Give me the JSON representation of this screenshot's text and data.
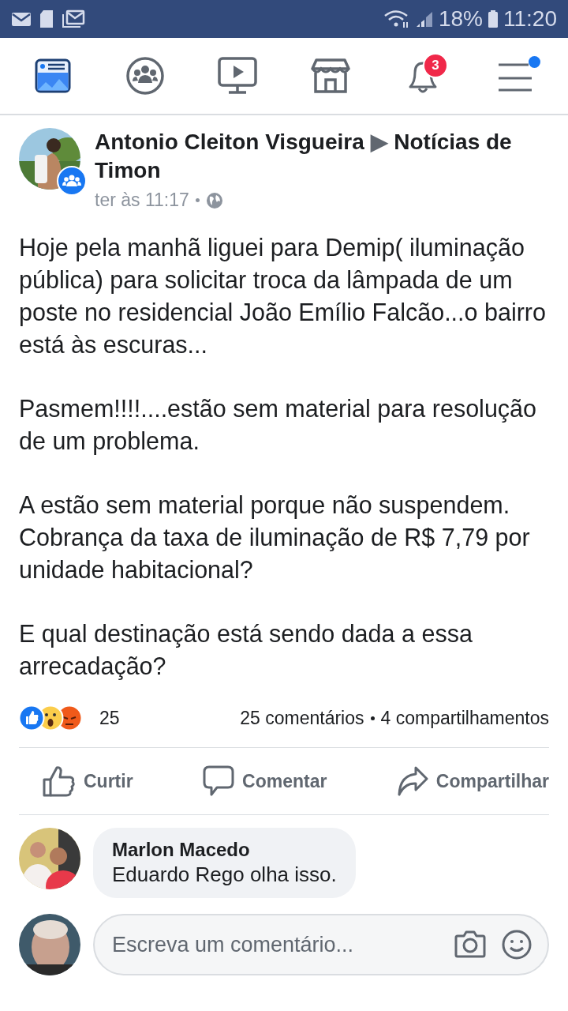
{
  "status_bar": {
    "battery": "18%",
    "time": "11:20"
  },
  "nav_tabs": [
    {
      "kind": "news",
      "selected": true
    },
    {
      "kind": "groups",
      "selected": false
    },
    {
      "kind": "video",
      "selected": false
    },
    {
      "kind": "market",
      "selected": false
    },
    {
      "kind": "bell",
      "selected": false,
      "badge": "3"
    },
    {
      "kind": "menu",
      "selected": false,
      "unread_dot": true
    }
  ],
  "post": {
    "author": "Antonio Cleiton Visgueira",
    "separator": "▶",
    "group": "Notícias de Timon",
    "time": "ter às 11:17",
    "paragraphs": [
      "Hoje pela manhã liguei para Demip( iluminação pública) para solicitar troca da lâmpada de um poste no residencial João Emílio Falcão...o bairro está às escuras...",
      "Pasmem!!!!....estão sem material para resolução de um problema.",
      "A estão sem material porque não suspendem. Cobrança da taxa de iluminação de R$ 7,79 por unidade habitacional?",
      "E qual destinação está sendo dada a essa arrecadação?"
    ],
    "reactions_count": "25",
    "comments_count": "25 comentários",
    "shares_count": "4 compartilhamentos",
    "actions": [
      {
        "kind": "like",
        "label": "Curtir"
      },
      {
        "kind": "comment",
        "label": "Comentar"
      },
      {
        "kind": "share",
        "label": "Compartilhar"
      }
    ]
  },
  "comments": [
    {
      "author": "Marlon Macedo",
      "text": "Eduardo Rego olha isso."
    }
  ],
  "comment_field": {
    "placeholder": "Escreva um comentário..."
  }
}
